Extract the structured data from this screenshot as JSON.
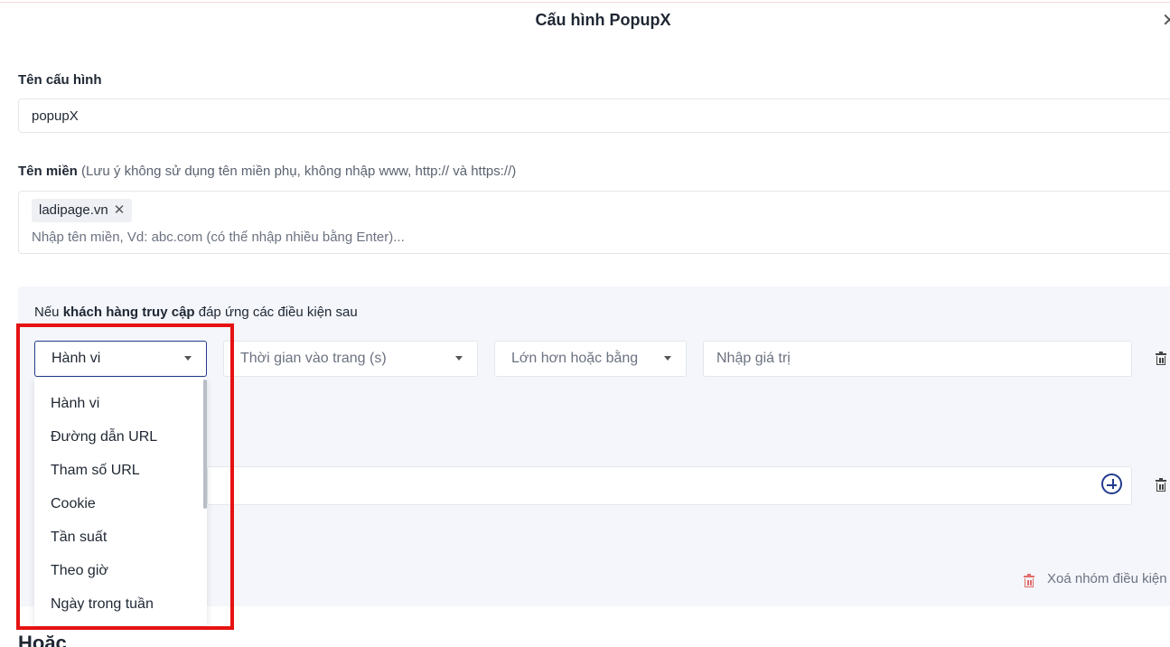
{
  "dialog": {
    "title": "Cấu hình PopupX"
  },
  "config_name": {
    "label": "Tên cấu hình",
    "value": "popupX"
  },
  "domain": {
    "label": "Tên miền",
    "note": "(Lưu ý không sử dụng tên miền phụ, không nhập www, http:// và https://)",
    "tags": [
      "ladipage.vn"
    ],
    "placeholder": "Nhập tên miền, Vd: abc.com (có thể nhập nhiều bằng Enter)..."
  },
  "conditions": {
    "intro_prefix": "Nếu",
    "intro_bold": "khách hàng truy cập",
    "intro_suffix": "đáp ứng các điều kiện sau",
    "type_select": "Hành vi",
    "behavior_select": "Thời gian vào trang (s)",
    "operator_select": "Lớn hơn hoặc bằng",
    "value_placeholder": "Nhập giá trị",
    "delete_group": "Xoá nhóm điều kiện"
  },
  "dropdown": {
    "options": [
      "Hành vi",
      "Đường dẫn URL",
      "Tham số URL",
      "Cookie",
      "Tần suất",
      "Theo giờ",
      "Ngày trong tuần"
    ]
  },
  "or_label": "Hoặc",
  "colors": {
    "accent": "#233b8e",
    "highlight": "#e61212",
    "panel": "#f4f6fb"
  }
}
